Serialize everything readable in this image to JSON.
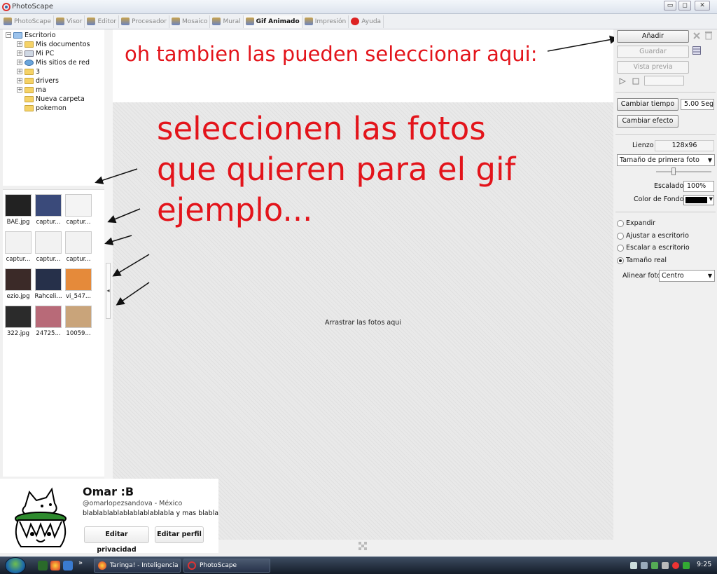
{
  "window": {
    "title": "PhotoScape",
    "min_glyph": "▭",
    "max_glyph": "◻",
    "close_glyph": "✕"
  },
  "menu": {
    "tabs": [
      {
        "label": "PhotoScape",
        "active": false
      },
      {
        "label": "Visor",
        "active": false
      },
      {
        "label": "Editor",
        "active": false
      },
      {
        "label": "Procesador",
        "active": false
      },
      {
        "label": "Mosaico",
        "active": false
      },
      {
        "label": "Mural",
        "active": false
      },
      {
        "label": "Gif Animado",
        "active": true
      },
      {
        "label": "Impresión",
        "active": false
      },
      {
        "label": "Ayuda",
        "active": false
      }
    ]
  },
  "tree": {
    "root": "Escritorio",
    "items": [
      "Mis documentos",
      "Mi PC",
      "Mis sitios de red",
      "3",
      "drivers",
      "ma",
      "Nueva carpeta",
      "pokemon"
    ]
  },
  "thumbs": [
    {
      "caption": "BAE.jpg",
      "color": "#222222"
    },
    {
      "caption": "captur...",
      "color": "#3a4a7a"
    },
    {
      "caption": "captur...",
      "color": "#f4f4f4"
    },
    {
      "caption": "captur...",
      "color": "#f2f2f2"
    },
    {
      "caption": "captur...",
      "color": "#f2f2f2"
    },
    {
      "caption": "captur...",
      "color": "#f2f2f2"
    },
    {
      "caption": "ezio.jpg",
      "color": "#3b2a28"
    },
    {
      "caption": "Rahceli...",
      "color": "#26304a"
    },
    {
      "caption": "vi_547...",
      "color": "#e58a3a"
    },
    {
      "caption": "322.jpg",
      "color": "#2b2b2b"
    },
    {
      "caption": "24725...",
      "color": "#b86a78"
    },
    {
      "caption": "10059...",
      "color": "#c9a47a"
    }
  ],
  "annotations": {
    "top": "oh tambien las pueden seleccionar aqui:",
    "main_line1": "seleccionen las fotos",
    "main_line2": "que quieren para el gif",
    "main_line3": "ejemplo...",
    "color": "#e3141b"
  },
  "canvas": {
    "drop_hint": "Arrastrar las fotos aqui"
  },
  "panel": {
    "add_label": "Añadir",
    "save_label": "Guardar",
    "preview_label": "Vista previa",
    "change_time_label": "Cambiar tiempo",
    "time_value": "5.00 Seg",
    "change_effect_label": "Cambiar efecto",
    "canvas_label": "Lienzo",
    "canvas_value": "128x96",
    "size_select": "Tamaño de primera foto",
    "scale_label": "Escalado",
    "scale_value": "100%",
    "bg_label": "Color de Fondo",
    "bg_color": "#000000",
    "radios": [
      {
        "label": "Expandir",
        "selected": false
      },
      {
        "label": "Ajustar a escritorio",
        "selected": false
      },
      {
        "label": "Escalar a escritorio",
        "selected": false
      },
      {
        "label": "Tamaño real",
        "selected": true
      }
    ],
    "align_label": "Alinear foto",
    "align_value": "Centro"
  },
  "profile": {
    "name": "Omar :B",
    "handle": "@omarlopezsandova - México",
    "bio": "blablablablablablablablabla y mas blabla",
    "privacy_button": "Editar privacidad",
    "edit_profile_button": "Editar perfil"
  },
  "taskbar": {
    "tasks": [
      "Taringa! - Inteligencia ...",
      "PhotoScape"
    ],
    "clock": "9:25"
  }
}
